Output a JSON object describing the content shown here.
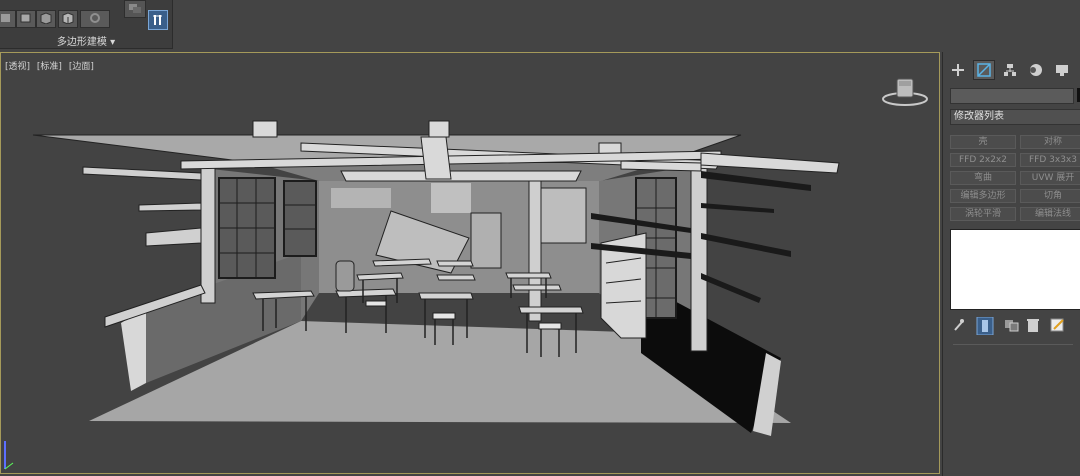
{
  "ribbon": {
    "group_title": "多边形建模 ▾",
    "tools": [
      "edge-tool-icon",
      "box-icon",
      "cube-icon",
      "shaded-cube-icon",
      "ring-icon"
    ]
  },
  "viewport": {
    "labels": [
      "[透视]",
      "[标准]",
      "[边面]"
    ],
    "border_color": "#a59a5a",
    "background": "#434343"
  },
  "command_panel": {
    "tabs": [
      "create-plus-icon",
      "modify-icon",
      "hierarchy-icon",
      "motion-icon",
      "display-icon"
    ],
    "active_tab": "modify-icon",
    "modifier_list_label": "修改器列表",
    "modifier_buttons": [
      {
        "label": "壳",
        "col": 0,
        "row": 0
      },
      {
        "label": "对称",
        "col": 1,
        "row": 0
      },
      {
        "label": "FFD 2x2x2",
        "col": 0,
        "row": 1
      },
      {
        "label": "FFD 3x3x3",
        "col": 1,
        "row": 1
      },
      {
        "label": "弯曲",
        "col": 0,
        "row": 2
      },
      {
        "label": "UVW 展开",
        "col": 1,
        "row": 2
      },
      {
        "label": "编辑多边形",
        "col": 0,
        "row": 3
      },
      {
        "label": "切角",
        "col": 1,
        "row": 3
      },
      {
        "label": "涡轮平滑",
        "col": 0,
        "row": 4
      },
      {
        "label": "编辑法线",
        "col": 1,
        "row": 4
      }
    ],
    "stack_tools": [
      "pin-icon",
      "show-end-result-icon",
      "make-unique-icon",
      "remove-modifier-icon",
      "configure-icon"
    ]
  },
  "colors": {
    "active_blue": "#3a5f8a",
    "stack_bg": "#ffffff"
  }
}
